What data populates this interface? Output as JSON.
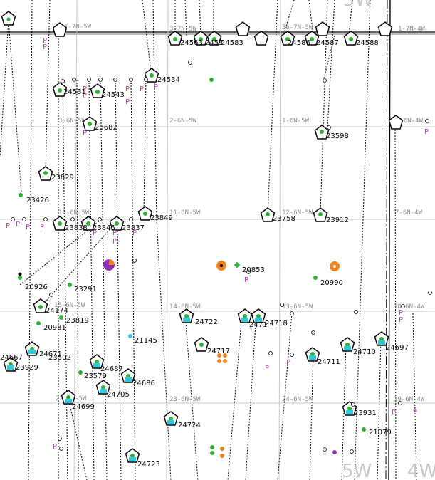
{
  "colors": {
    "grid": "#c8c8c8",
    "well_green": "#2fb02f",
    "well_cyan": "#30c8e0",
    "well_orange": "#f08020",
    "permit_magenta": "#cc33cc",
    "purple": "#9030b0",
    "label": "#000000"
  },
  "township_labels": {
    "top_left": "5W",
    "bottom_mid": "5W",
    "bottom_right": "4W"
  },
  "section_labels": [
    {
      "id": "s1",
      "text": "1-7N-5W"
    },
    {
      "id": "s2",
      "text": "3-7N-5W"
    },
    {
      "id": "s3",
      "text": "36-7N-5W"
    },
    {
      "id": "s4",
      "text": "1-7N-4W"
    },
    {
      "id": "s5",
      "text": "3-6N-5W"
    },
    {
      "id": "s6",
      "text": "2-6N-5W"
    },
    {
      "id": "s7",
      "text": "1-6N-5W"
    },
    {
      "id": "s8",
      "text": "6-6N-4W"
    },
    {
      "id": "s9",
      "text": "10-6N-5W"
    },
    {
      "id": "s10",
      "text": "11-6N-5W"
    },
    {
      "id": "s11",
      "text": "12-6N-5W"
    },
    {
      "id": "s12",
      "text": "7-6N-4W"
    },
    {
      "id": "s13",
      "text": "15-6N-5W"
    },
    {
      "id": "s14",
      "text": "14-6N-5W"
    },
    {
      "id": "s15",
      "text": "13-6N-5W"
    },
    {
      "id": "s16",
      "text": "18-6N-4W"
    },
    {
      "id": "s17",
      "text": "22-6N-5W"
    },
    {
      "id": "s18",
      "text": "23-6N-5W"
    },
    {
      "id": "s19",
      "text": "24-6N-5W"
    },
    {
      "id": "s20",
      "text": "19-6N-4W"
    }
  ],
  "well_labels": [
    {
      "id": "w24563",
      "text": "24563"
    },
    {
      "id": "w24531t",
      "text": "2453"
    },
    {
      "id": "w24583",
      "text": "24583"
    },
    {
      "id": "w24586",
      "text": "24586"
    },
    {
      "id": "w24587",
      "text": "24587"
    },
    {
      "id": "w24588",
      "text": "24588"
    },
    {
      "id": "w24534",
      "text": "24534"
    },
    {
      "id": "w24531",
      "text": "24531"
    },
    {
      "id": "w24543",
      "text": "24543"
    },
    {
      "id": "w23682",
      "text": "23682"
    },
    {
      "id": "w23598",
      "text": "23598"
    },
    {
      "id": "w23829",
      "text": "23829"
    },
    {
      "id": "w23426",
      "text": "23426"
    },
    {
      "id": "w23838",
      "text": "23838"
    },
    {
      "id": "w23845",
      "text": "23845"
    },
    {
      "id": "w23837",
      "text": "23837"
    },
    {
      "id": "w23849",
      "text": "23849"
    },
    {
      "id": "w23758",
      "text": "23758"
    },
    {
      "id": "w23912",
      "text": "23912"
    },
    {
      "id": "w20853",
      "text": "20853"
    },
    {
      "id": "w20990",
      "text": "20990"
    },
    {
      "id": "w20926",
      "text": "20926"
    },
    {
      "id": "w23291",
      "text": "23291"
    },
    {
      "id": "w24174",
      "text": "24174"
    },
    {
      "id": "w23819",
      "text": "23819"
    },
    {
      "id": "w20981",
      "text": "20981"
    },
    {
      "id": "w24722",
      "text": "24722"
    },
    {
      "id": "w2471",
      "text": "2471"
    },
    {
      "id": "w24718",
      "text": "24718"
    },
    {
      "id": "w21145",
      "text": "21145"
    },
    {
      "id": "w24667",
      "text": "24667"
    },
    {
      "id": "w24671",
      "text": "24671"
    },
    {
      "id": "w23502",
      "text": "23502"
    },
    {
      "id": "w23929",
      "text": "23929"
    },
    {
      "id": "w24717",
      "text": "24717"
    },
    {
      "id": "w24711",
      "text": "24711"
    },
    {
      "id": "w24710",
      "text": "24710"
    },
    {
      "id": "w24697",
      "text": "24697"
    },
    {
      "id": "w24687",
      "text": "24687"
    },
    {
      "id": "w23579",
      "text": "23579"
    },
    {
      "id": "w24686",
      "text": "24686"
    },
    {
      "id": "w24705",
      "text": "24705"
    },
    {
      "id": "w24699",
      "text": "24699"
    },
    {
      "id": "w24724",
      "text": "24724"
    },
    {
      "id": "w23931",
      "text": "23931"
    },
    {
      "id": "w21079",
      "text": "21079"
    },
    {
      "id": "w24723",
      "text": "24723"
    }
  ],
  "permit_marker": "P"
}
